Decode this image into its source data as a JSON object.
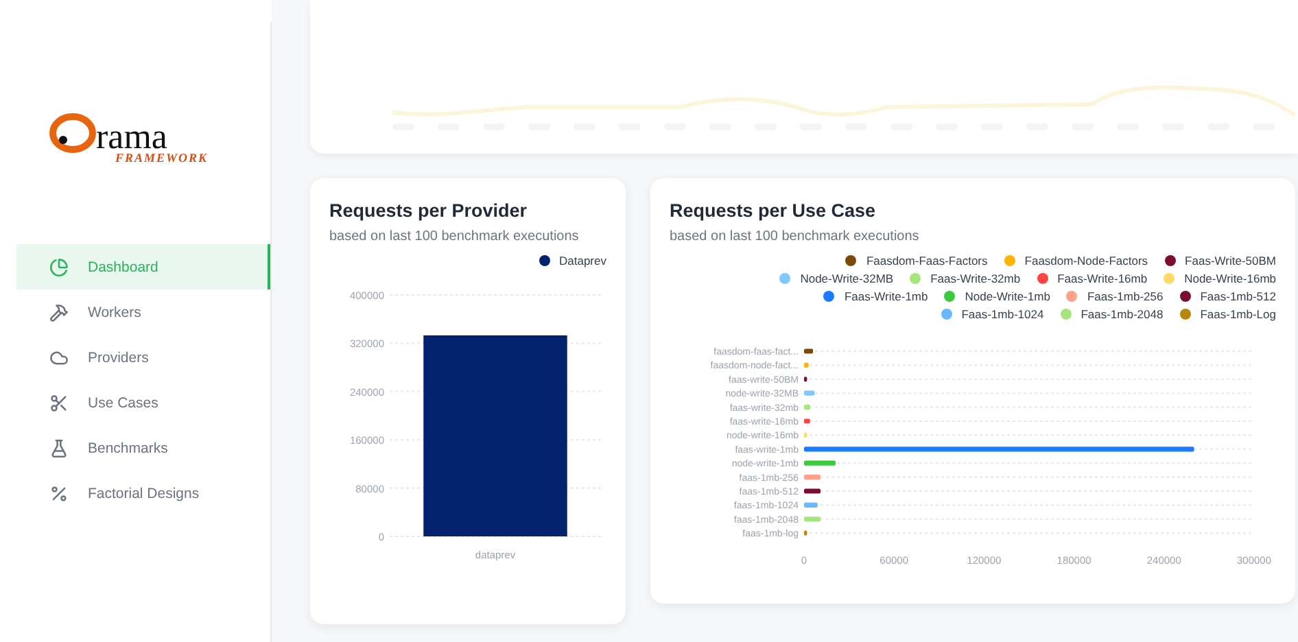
{
  "logo": {
    "word": "rama",
    "tagline": "FRAMEWORK"
  },
  "sidebar": {
    "items": [
      {
        "label": "Dashboard",
        "selected": true
      },
      {
        "label": "Workers",
        "selected": false
      },
      {
        "label": "Providers",
        "selected": false
      },
      {
        "label": "Use Cases",
        "selected": false
      },
      {
        "label": "Benchmarks",
        "selected": false
      },
      {
        "label": "Factorial Designs",
        "selected": false
      }
    ]
  },
  "provider_card": {
    "title": "Requests per Provider",
    "subtitle": "based on last 100 benchmark executions",
    "chart_data": {
      "type": "bar",
      "grid": true,
      "legend": true,
      "categories": [
        "dataprev"
      ],
      "series": [
        {
          "name": "Dataprev",
          "color": "#04236f",
          "values": [
            333000
          ]
        }
      ],
      "ylim": [
        0,
        400000
      ],
      "yticks": [
        0,
        80000,
        160000,
        240000,
        320000,
        400000
      ]
    }
  },
  "use_case_card": {
    "title": "Requests per Use Case",
    "subtitle": "based on last 100 benchmark executions",
    "chart_data": {
      "type": "bar",
      "orientation": "horizontal",
      "grid": true,
      "legend": true,
      "categories": [
        "faasdom-faas-fact...",
        "faasdom-node-fact...",
        "faas-write-50BM",
        "node-write-32MB",
        "faas-write-32mb",
        "faas-write-16mb",
        "node-write-16mb",
        "faas-write-1mb",
        "node-write-1mb",
        "faas-1mb-256",
        "faas-1mb-512",
        "faas-1mb-1024",
        "faas-1mb-2048",
        "faas-1mb-log"
      ],
      "series": [
        {
          "name": "Faasdom-Faas-Factors",
          "color": "#7a4a0a",
          "values": [
            6000,
            null,
            null,
            null,
            null,
            null,
            null,
            null,
            null,
            null,
            null,
            null,
            null,
            null
          ]
        },
        {
          "name": "Faasdom-Node-Factors",
          "color": "#ffb300",
          "values": [
            null,
            3000,
            null,
            null,
            null,
            null,
            null,
            null,
            null,
            null,
            null,
            null,
            null,
            null
          ]
        },
        {
          "name": "Faas-Write-50BM",
          "color": "#7a0f2e",
          "values": [
            null,
            null,
            2000,
            null,
            null,
            null,
            null,
            null,
            null,
            null,
            null,
            null,
            null,
            null
          ]
        },
        {
          "name": "Node-Write-32MB",
          "color": "#80c8ff",
          "values": [
            null,
            null,
            null,
            7000,
            null,
            null,
            null,
            null,
            null,
            null,
            null,
            null,
            null,
            null
          ]
        },
        {
          "name": "Faas-Write-32mb",
          "color": "#a6e57a",
          "values": [
            null,
            null,
            null,
            null,
            4000,
            null,
            null,
            null,
            null,
            null,
            null,
            null,
            null,
            null
          ]
        },
        {
          "name": "Faas-Write-16mb",
          "color": "#ff4444",
          "values": [
            null,
            null,
            null,
            null,
            null,
            4000,
            null,
            null,
            null,
            null,
            null,
            null,
            null,
            null
          ]
        },
        {
          "name": "Node-Write-16mb",
          "color": "#ffd966",
          "values": [
            null,
            null,
            null,
            null,
            null,
            null,
            2000,
            null,
            null,
            null,
            null,
            null,
            null,
            null
          ]
        },
        {
          "name": "Faas-Write-1mb",
          "color": "#1a7cff",
          "values": [
            null,
            null,
            null,
            null,
            null,
            null,
            null,
            260000,
            null,
            null,
            null,
            null,
            null,
            null
          ]
        },
        {
          "name": "Node-Write-1mb",
          "color": "#3cc93c",
          "values": [
            null,
            null,
            null,
            null,
            null,
            null,
            null,
            null,
            21000,
            null,
            null,
            null,
            null,
            null
          ]
        },
        {
          "name": "Faas-1mb-256",
          "color": "#ffa08a",
          "values": [
            null,
            null,
            null,
            null,
            null,
            null,
            null,
            null,
            null,
            11000,
            null,
            null,
            null,
            null
          ]
        },
        {
          "name": "Faas-1mb-512",
          "color": "#7a0f2f",
          "values": [
            null,
            null,
            null,
            null,
            null,
            null,
            null,
            null,
            null,
            null,
            11000,
            null,
            null,
            null
          ]
        },
        {
          "name": "Faas-1mb-1024",
          "color": "#6ab8ff",
          "values": [
            null,
            null,
            null,
            null,
            null,
            null,
            null,
            null,
            null,
            null,
            null,
            9000,
            null,
            null
          ]
        },
        {
          "name": "Faas-1mb-2048",
          "color": "#a6e57b",
          "values": [
            null,
            null,
            null,
            null,
            null,
            null,
            null,
            null,
            null,
            null,
            null,
            null,
            11000,
            null
          ]
        },
        {
          "name": "Faas-1mb-Log",
          "color": "#b8860b",
          "values": [
            null,
            null,
            null,
            null,
            null,
            null,
            null,
            null,
            null,
            null,
            null,
            null,
            null,
            2000
          ]
        }
      ],
      "xlim": [
        0,
        300000
      ],
      "xticks": [
        0,
        60000,
        120000,
        180000,
        240000,
        300000
      ]
    }
  }
}
